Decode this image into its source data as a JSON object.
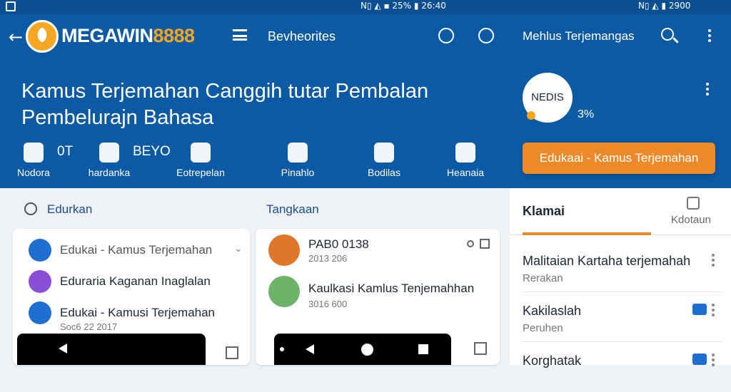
{
  "status": {
    "left_text": "N▯ ◭ ▪ 25% ▮ 26:40",
    "right_text": "N▯ ◭ ▮ 2900"
  },
  "appbar": {
    "brand_main": "MEGAWIN",
    "brand_num": "8888",
    "title": "Bevheorites"
  },
  "appbar2": {
    "title": "Mehlus Terjemangas"
  },
  "hero": {
    "title": "Kamus Terjemahan Canggih tutar Pembalan Pembelurajn Bahasa",
    "features": [
      {
        "label": "Nodora",
        "value": "0T"
      },
      {
        "label": "hardanka",
        "value": "BEYO"
      },
      {
        "label": "Eotrepelan",
        "value": ""
      },
      {
        "label": "Pinahlo",
        "value": ""
      },
      {
        "label": "Bodilas",
        "value": ""
      },
      {
        "label": "Heanaia",
        "value": ""
      }
    ]
  },
  "profile": {
    "avatar_text": "NEDIS",
    "percent": "3%",
    "cta_label": "Edukaai - Kamus Terjemahan"
  },
  "left_section": {
    "label": "Edurkan",
    "items": [
      {
        "title": "Edukai - Kamus Terjemahan",
        "sub": ""
      },
      {
        "title": "Eduraria Kaganan Inaglalan",
        "sub": ""
      },
      {
        "title": "Edukai - Kamusi Terjemahan",
        "sub": "Soc6 22 2017"
      }
    ]
  },
  "mid_section": {
    "label": "Tangkaan",
    "items": [
      {
        "title": "PAB0 0138",
        "sub": "2013 206"
      },
      {
        "title": "Kaulkasi Kamlus Tenjemahhan",
        "sub": "3016 600"
      }
    ]
  },
  "right_panel": {
    "tab_active": "Klamai",
    "tab_other": "Kdotaun",
    "items": [
      {
        "title": "Malitaian Kartaha terjemahah",
        "sub": "Rerakan"
      },
      {
        "title": "Kakilaslah",
        "sub": "Peruhen"
      },
      {
        "title": "Korghatak",
        "sub": ""
      }
    ]
  }
}
